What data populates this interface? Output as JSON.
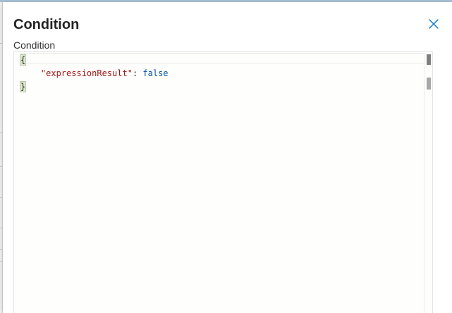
{
  "panel": {
    "title": "Condition",
    "close_icon": "close-icon"
  },
  "field": {
    "label": "Condition"
  },
  "editor": {
    "lines": [
      {
        "text": "{"
      },
      {
        "indent": "    ",
        "key": "\"expressionResult\"",
        "separator": ": ",
        "value": "false"
      },
      {
        "text": "}"
      }
    ],
    "colors": {
      "key": "#a31515",
      "bool": "#0451a5",
      "bracket_highlight": "#dde9cf"
    }
  },
  "colors": {
    "accent": "#0078d4",
    "title_text": "#252423"
  }
}
